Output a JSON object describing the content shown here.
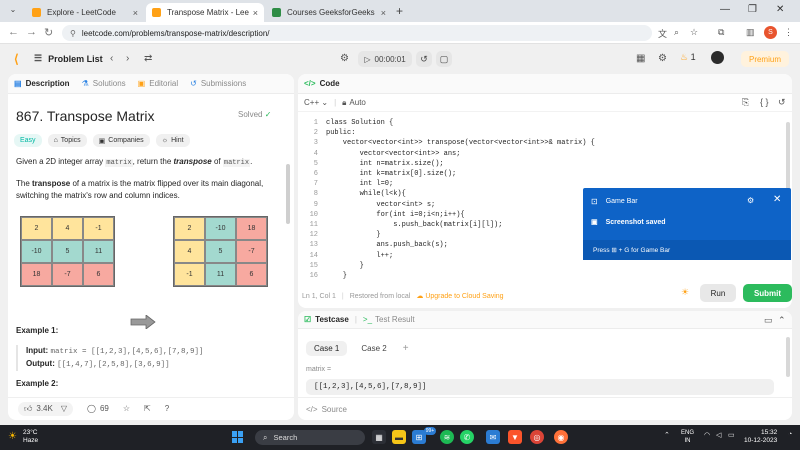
{
  "browser": {
    "tabs": [
      {
        "title": "Explore - LeetCode",
        "favicon_color": "#ffa116"
      },
      {
        "title": "Transpose Matrix - LeetCode",
        "favicon_color": "#ffa116"
      },
      {
        "title": "Courses GeeksforGeeks | Intera",
        "favicon_color": "#2f8d46"
      }
    ],
    "url": "leetcode.com/problems/transpose-matrix/description/",
    "profile_initial": "S"
  },
  "header": {
    "problem_list": "Problem List",
    "timer": "00:00:01",
    "streak": "1",
    "premium": "Premium"
  },
  "left": {
    "tabs": [
      {
        "label": "Description"
      },
      {
        "label": "Solutions"
      },
      {
        "label": "Editorial"
      },
      {
        "label": "Submissions"
      }
    ],
    "title": "867. Transpose Matrix",
    "solved": "Solved",
    "badges": [
      "Easy",
      "Topics",
      "Companies",
      "Hint"
    ],
    "desc1_pre": "Given a 2D integer array ",
    "desc1_code1": "matrix",
    "desc1_mid": ", return the ",
    "desc1_em": "transpose",
    "desc1_mid2": " of ",
    "desc1_code2": "matrix",
    "desc1_end": ".",
    "desc2_pre": "The ",
    "desc2_strong": "transpose",
    "desc2_rest": " of a matrix is the matrix flipped over its main diagonal, switching the matrix's row and column indices.",
    "matrix_before": [
      [
        "2",
        "4",
        "-1"
      ],
      [
        "-10",
        "5",
        "11"
      ],
      [
        "18",
        "-7",
        "6"
      ]
    ],
    "matrix_after": [
      [
        "2",
        "-10",
        "18"
      ],
      [
        "4",
        "5",
        "-7"
      ],
      [
        "-1",
        "11",
        "6"
      ]
    ],
    "example1_title": "Example 1:",
    "example1_input_label": "Input:",
    "example1_input": "matrix = [[1,2,3],[4,5,6],[7,8,9]]",
    "example1_output_label": "Output:",
    "example1_output": "[[1,4,7],[2,5,8],[3,6,9]]",
    "example2_title": "Example 2:",
    "likes": "3.4K",
    "comments": "69"
  },
  "code": {
    "title": "Code",
    "language": "C++",
    "mode": "Auto",
    "lines": [
      "class Solution {",
      "public:",
      "    vector<vector<int>> transpose(vector<vector<int>>& matrix) {",
      "        vector<vector<int>> ans;",
      "        int n=matrix.size();",
      "        int k=matrix[0].size();",
      "        int l=0;",
      "        while(l<k){",
      "            vector<int> s;",
      "            for(int i=0;i<n;i++){",
      "                s.push_back(matrix[i][l]);",
      "            }",
      "            ans.push_back(s);",
      "            l++;",
      "        }",
      "    }"
    ],
    "cursor": "Ln 1, Col 1",
    "saved": "Restored from local",
    "upgrade": "Upgrade to Cloud Saving",
    "run": "Run",
    "submit": "Submit"
  },
  "testcase": {
    "tab_active": "Testcase",
    "tab_result": "Test Result",
    "cases": [
      "Case 1",
      "Case 2"
    ],
    "param_name": "matrix =",
    "param_value": "[[1,2,3],[4,5,6],[7,8,9]]",
    "source": "Source"
  },
  "gamebar": {
    "title": "Game Bar",
    "message": "Screenshot saved",
    "footer": "Press ⊞ + G for Game Bar"
  },
  "taskbar": {
    "temp": "23°C",
    "weather": "Haze",
    "search": "Search",
    "lang1": "ENG",
    "lang2": "IN",
    "time": "15:32",
    "date": "10-12-2023",
    "badge": "99+"
  },
  "colors": {
    "accent": "#ffa116",
    "success": "#2cbb5d",
    "gamebar": "#0e63c7",
    "cell_yellow": "#ffe49c",
    "cell_teal": "#a3d9cf",
    "cell_red": "#f7a9a0"
  }
}
